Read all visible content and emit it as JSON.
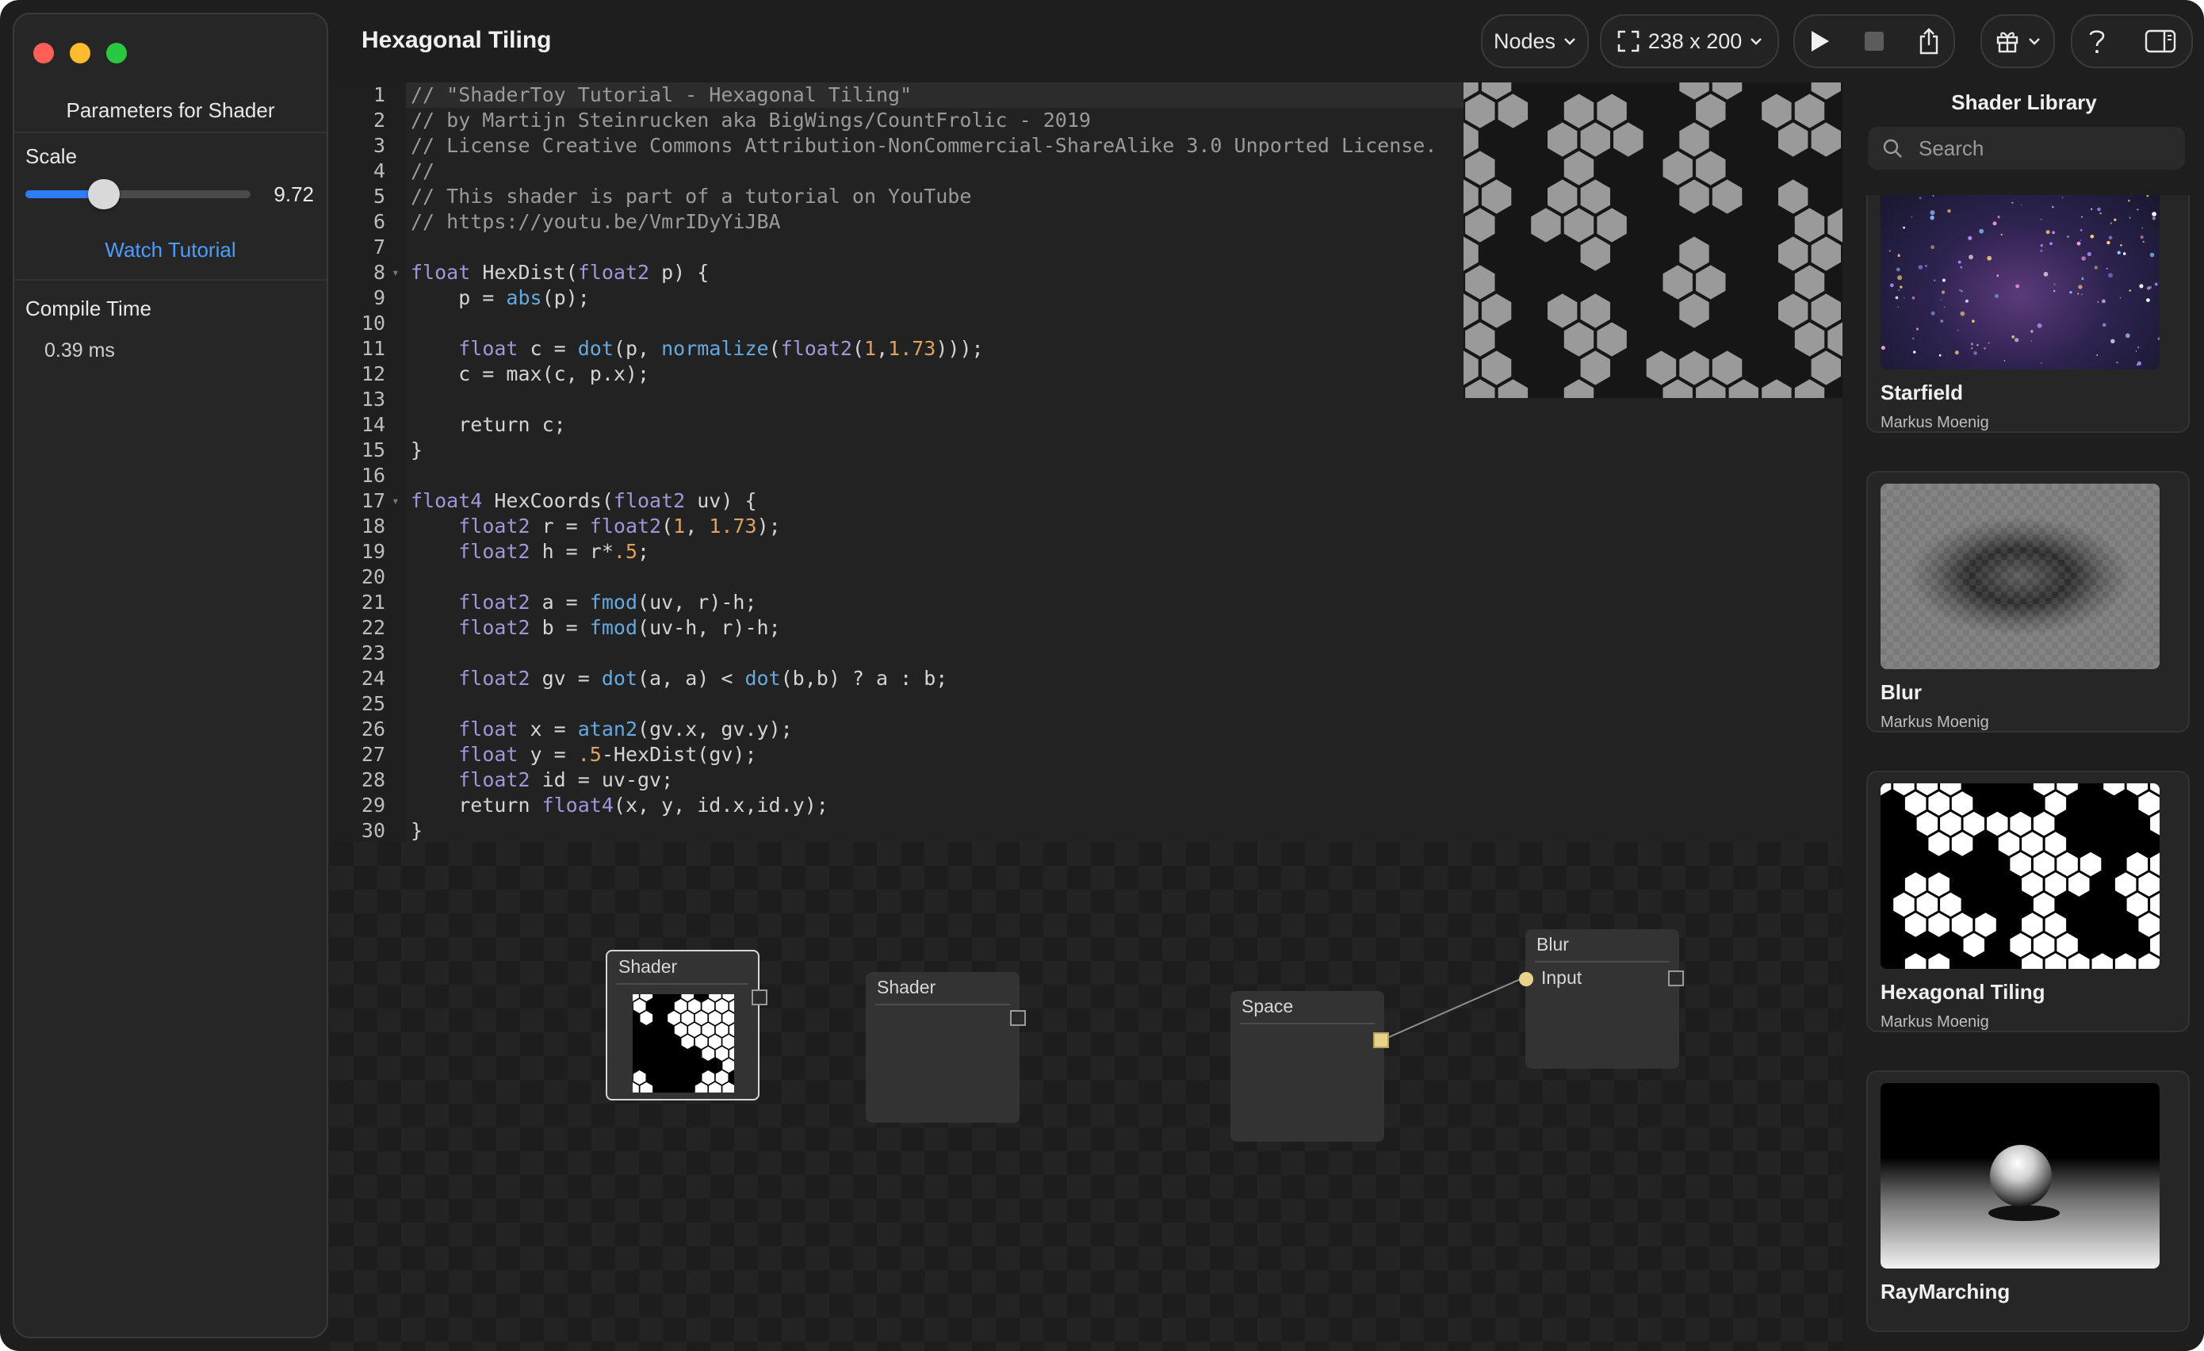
{
  "app": {
    "title": "Hexagonal Tiling"
  },
  "sidebar": {
    "title": "Parameters for Shader",
    "scale": {
      "label": "Scale",
      "value": "9.72",
      "fraction": 0.35
    },
    "tutorial_link": "Watch Tutorial",
    "compile": {
      "label": "Compile Time",
      "value": "0.39 ms"
    }
  },
  "toolbar": {
    "view_mode": "Nodes",
    "resolution": "238 x 200"
  },
  "editor": {
    "current_line": 1,
    "foldable_lines": [
      8,
      17
    ],
    "lines": [
      [
        [
          "com",
          "// \"ShaderToy Tutorial - Hexagonal Tiling\""
        ]
      ],
      [
        [
          "com",
          "// by Martijn Steinrucken aka BigWings/CountFrolic - 2019"
        ]
      ],
      [
        [
          "com",
          "// License Creative Commons Attribution-NonCommercial-ShareAlike 3.0 Unported License."
        ]
      ],
      [
        [
          "com",
          "//"
        ]
      ],
      [
        [
          "com",
          "// This shader is part of a tutorial on YouTube"
        ]
      ],
      [
        [
          "com",
          "// https://youtu.be/VmrIDyYiJBA"
        ]
      ],
      [],
      [
        [
          "type",
          "float"
        ],
        [
          "plain",
          " HexDist("
        ],
        [
          "type",
          "float2"
        ],
        [
          "plain",
          " p) {"
        ]
      ],
      [
        [
          "plain",
          "    p = "
        ],
        [
          "fn",
          "abs"
        ],
        [
          "plain",
          "(p);"
        ]
      ],
      [],
      [
        [
          "plain",
          "    "
        ],
        [
          "type",
          "float"
        ],
        [
          "plain",
          " c = "
        ],
        [
          "fn",
          "dot"
        ],
        [
          "plain",
          "(p, "
        ],
        [
          "fn",
          "normalize"
        ],
        [
          "plain",
          "("
        ],
        [
          "type",
          "float2"
        ],
        [
          "plain",
          "("
        ],
        [
          "num",
          "1"
        ],
        [
          "plain",
          ","
        ],
        [
          "num",
          "1.73"
        ],
        [
          "plain",
          ")));"
        ]
      ],
      [
        [
          "plain",
          "    c = max(c, p.x);"
        ]
      ],
      [],
      [
        [
          "plain",
          "    return c;"
        ]
      ],
      [
        [
          "plain",
          "}"
        ]
      ],
      [],
      [
        [
          "type",
          "float4"
        ],
        [
          "plain",
          " HexCoords("
        ],
        [
          "type",
          "float2"
        ],
        [
          "plain",
          " uv) {"
        ]
      ],
      [
        [
          "plain",
          "    "
        ],
        [
          "type",
          "float2"
        ],
        [
          "plain",
          " r = "
        ],
        [
          "type",
          "float2"
        ],
        [
          "plain",
          "("
        ],
        [
          "num",
          "1"
        ],
        [
          "plain",
          ", "
        ],
        [
          "num",
          "1.73"
        ],
        [
          "plain",
          ");"
        ]
      ],
      [
        [
          "plain",
          "    "
        ],
        [
          "type",
          "float2"
        ],
        [
          "plain",
          " h = r*"
        ],
        [
          "num",
          ".5"
        ],
        [
          "plain",
          ";"
        ]
      ],
      [],
      [
        [
          "plain",
          "    "
        ],
        [
          "type",
          "float2"
        ],
        [
          "plain",
          " a = "
        ],
        [
          "fn",
          "fmod"
        ],
        [
          "plain",
          "(uv, r)-h;"
        ]
      ],
      [
        [
          "plain",
          "    "
        ],
        [
          "type",
          "float2"
        ],
        [
          "plain",
          " b = "
        ],
        [
          "fn",
          "fmod"
        ],
        [
          "plain",
          "(uv-h, r)-h;"
        ]
      ],
      [],
      [
        [
          "plain",
          "    "
        ],
        [
          "type",
          "float2"
        ],
        [
          "plain",
          " gv = "
        ],
        [
          "fn",
          "dot"
        ],
        [
          "plain",
          "(a, a) < "
        ],
        [
          "fn",
          "dot"
        ],
        [
          "plain",
          "(b,b) ? a : b;"
        ]
      ],
      [],
      [
        [
          "plain",
          "    "
        ],
        [
          "type",
          "float"
        ],
        [
          "plain",
          " x = "
        ],
        [
          "fn",
          "atan2"
        ],
        [
          "plain",
          "(gv.x, gv.y);"
        ]
      ],
      [
        [
          "plain",
          "    "
        ],
        [
          "type",
          "float"
        ],
        [
          "plain",
          " y = "
        ],
        [
          "num",
          ".5"
        ],
        [
          "plain",
          "-HexDist(gv);"
        ]
      ],
      [
        [
          "plain",
          "    "
        ],
        [
          "type",
          "float2"
        ],
        [
          "plain",
          " id = uv-gv;"
        ]
      ],
      [
        [
          "plain",
          "    return "
        ],
        [
          "type",
          "float4"
        ],
        [
          "plain",
          "(x, y, id.x,id.y);"
        ]
      ],
      [
        [
          "plain",
          "}"
        ]
      ]
    ]
  },
  "nodes": {
    "shader1": {
      "title": "Shader"
    },
    "shader2": {
      "title": "Shader"
    },
    "space": {
      "title": "Space"
    },
    "blur": {
      "title": "Blur",
      "input_label": "Input"
    }
  },
  "library": {
    "title": "Shader Library",
    "search_placeholder": "Search",
    "items": [
      {
        "name": "Starfield",
        "author": "Markus Moenig"
      },
      {
        "name": "Blur",
        "author": "Markus Moenig"
      },
      {
        "name": "Hexagonal Tiling",
        "author": "Markus Moenig"
      },
      {
        "name": "RayMarching",
        "author": ""
      }
    ]
  },
  "colors": {
    "accent": "#2f7cf6",
    "link": "#4a9cff",
    "port": "#e8d38a",
    "traffic_red": "#ff5f57",
    "traffic_yellow": "#febc2e",
    "traffic_green": "#28c840"
  },
  "icons": [
    "fullscreen-icon",
    "chevron-down-icon",
    "play-icon",
    "stop-icon",
    "share-icon",
    "gift-icon",
    "help-icon",
    "sidebar-toggle-icon",
    "search-icon",
    "fold-arrow-icon"
  ]
}
